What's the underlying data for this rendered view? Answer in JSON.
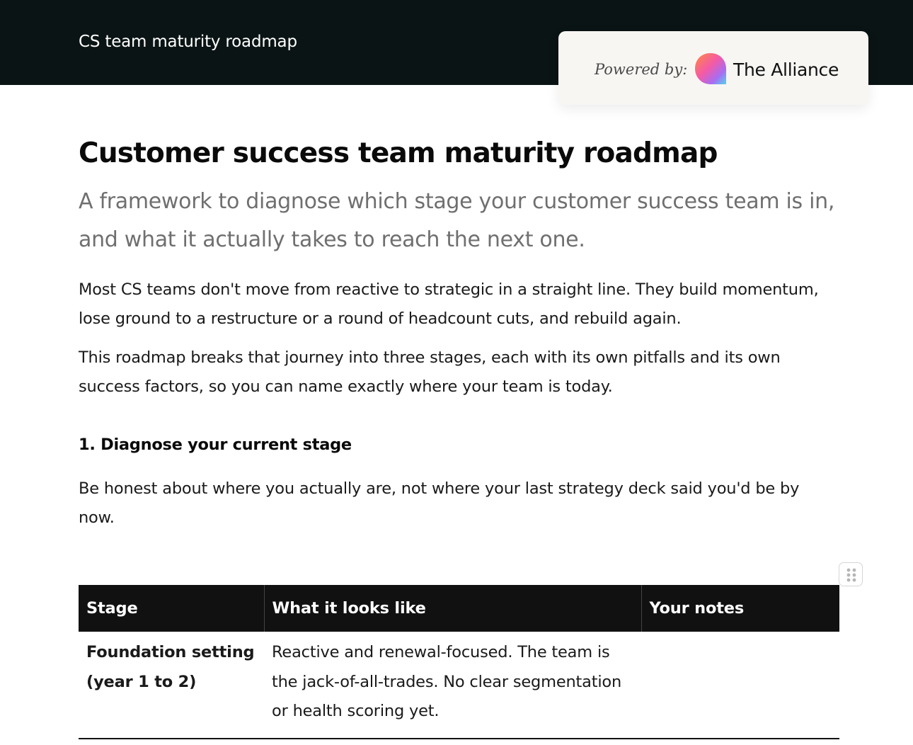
{
  "header": {
    "title": "CS team maturity roadmap"
  },
  "powered_by": {
    "label": "Powered by:",
    "brand": "The Alliance",
    "logo_icon": "alliance-logo-icon"
  },
  "doc": {
    "title": "Customer success team maturity roadmap",
    "subtitle": "A framework to diagnose which stage your customer success team is in, and what it actually takes to reach the next one.",
    "paragraphs": [
      "Most CS teams don't move from reactive to strategic in a straight line. They build momentum, lose ground to a restructure or a round of headcount cuts, and rebuild again.",
      "This roadmap breaks that journey into three stages, each with its own pitfalls and its own success factors, so you can name exactly where your team is today."
    ],
    "section1": {
      "heading": "1. Diagnose your current stage",
      "intro": "Be honest about where you actually are, not where your last strategy deck said you'd be by now."
    }
  },
  "table": {
    "headers": [
      "Stage",
      "What it looks like",
      "Your notes"
    ],
    "rows": [
      {
        "stage": "Foundation setting (year 1 to 2)",
        "looks_like": "Reactive and renewal-focused. The team is the jack-of-all-trades. No clear segmentation or health scoring yet.",
        "notes": ""
      }
    ]
  },
  "colors": {
    "topbar": "#0b1414",
    "table_header": "#111111",
    "subtitle": "#6f6f6f",
    "powered_bg": "#f7f6f3"
  }
}
